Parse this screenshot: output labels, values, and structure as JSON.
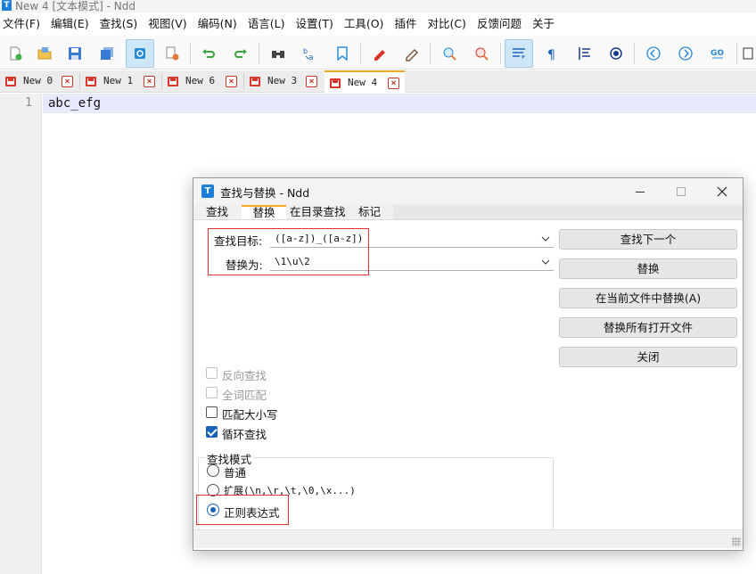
{
  "window": {
    "title": "New 4 [文本模式] - Ndd",
    "icon": "app-icon"
  },
  "menu": [
    "文件(F)",
    "编辑(E)",
    "查找(S)",
    "视图(V)",
    "编码(N)",
    "语言(L)",
    "设置(T)",
    "工具(O)",
    "插件",
    "对比(C)",
    "反馈问题",
    "关于"
  ],
  "toolbar_icons": [
    "new-file-icon",
    "open-folder-icon",
    "save-icon",
    "save-all-icon",
    "auto-save-icon",
    "close-file-icon",
    "undo-icon",
    "redo-icon",
    "find-icon",
    "replace-icon",
    "bookmark-icon",
    "mark-icon",
    "clear-mark-icon",
    "zoom-in-icon",
    "zoom-out-icon",
    "word-wrap-icon",
    "show-symbols-icon",
    "indent-guide-icon",
    "macro-icon",
    "prev-icon",
    "next-icon",
    "goto-icon",
    "more-icon"
  ],
  "tabs": [
    {
      "label": "New 0",
      "active": false
    },
    {
      "label": "New 1",
      "active": false
    },
    {
      "label": "New 6",
      "active": false
    },
    {
      "label": "New 3",
      "active": false
    },
    {
      "label": "New 4",
      "active": true
    }
  ],
  "editor": {
    "line_number": "1",
    "content": "abc_efg"
  },
  "dialog": {
    "title": "查找与替换 - Ndd",
    "tabs": [
      "查找",
      "替换",
      "在目录查找",
      "标记"
    ],
    "active_tab": "替换",
    "find_label": "查找目标:",
    "find_value": "([a-z])_([a-z])",
    "replace_label": "替换为:",
    "replace_value": "\\1\\u\\2",
    "buttons": {
      "find_next": "查找下一个",
      "replace": "替换",
      "replace_in_file": "在当前文件中替换(A)",
      "replace_all_open": "替换所有打开文件",
      "close": "关闭"
    },
    "options": {
      "reverse": {
        "label": "反向查找",
        "checked": false,
        "enabled": false
      },
      "whole_word": {
        "label": "全词匹配",
        "checked": false,
        "enabled": false
      },
      "match_case": {
        "label": "匹配大小写",
        "checked": false,
        "enabled": true
      },
      "wrap": {
        "label": "循环查找",
        "checked": true,
        "enabled": true
      }
    },
    "search_mode": {
      "title": "查找模式",
      "normal": "普通",
      "extended": "扩展(\\n,\\r,\\t,\\0,\\x...)",
      "regex": "正则表达式",
      "selected": "regex"
    }
  },
  "colors": {
    "accent": "#1a63b8",
    "tab_highlight": "#f5a623",
    "annotation_red": "#e03131",
    "current_line": "#e8e8ff"
  }
}
